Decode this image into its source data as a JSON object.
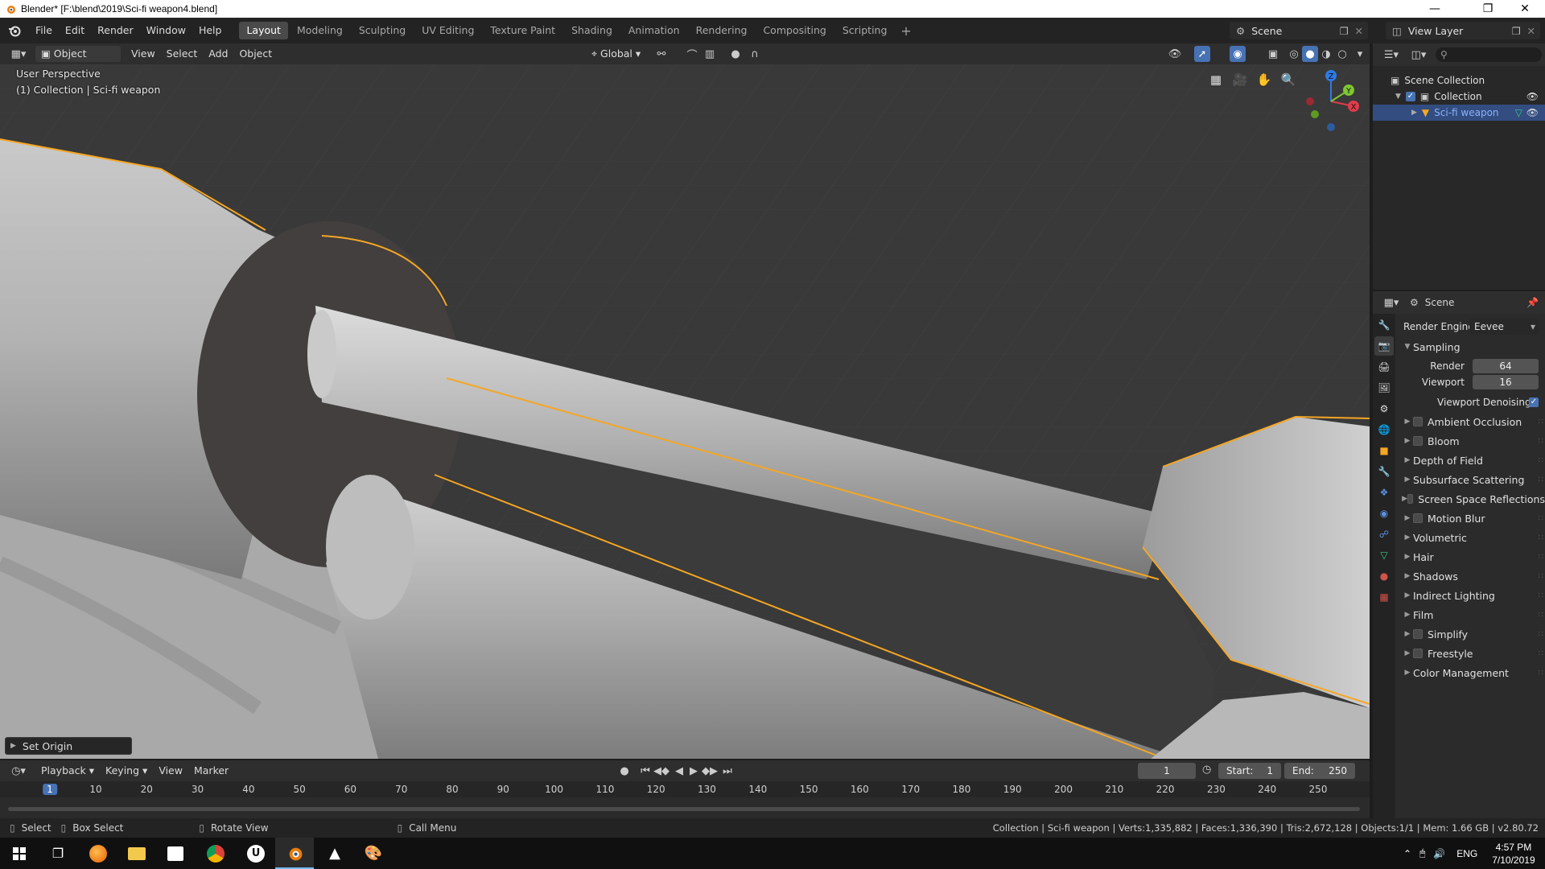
{
  "window": {
    "title": "Blender* [F:\\blend\\2019\\Sci-fi weapon4.blend]",
    "controls": [
      "minimize",
      "maximize",
      "close"
    ]
  },
  "topbar": {
    "menus": [
      "File",
      "Edit",
      "Render",
      "Window",
      "Help"
    ],
    "workspaces": [
      "Layout",
      "Modeling",
      "Sculpting",
      "UV Editing",
      "Texture Paint",
      "Shading",
      "Animation",
      "Rendering",
      "Compositing",
      "Scripting"
    ],
    "active_workspace": "Layout",
    "add_workspace": "+",
    "scene": "Scene",
    "view_layer": "View Layer"
  },
  "viewport_header": {
    "mode": "Object Mode",
    "menus": [
      "View",
      "Select",
      "Add",
      "Object"
    ],
    "orientation": "Global"
  },
  "viewport": {
    "perspective": "User Perspective",
    "collection_info": "(1) Collection | Sci-fi weapon",
    "gizmo_axes": [
      "X",
      "Y",
      "Z"
    ],
    "last_operator": "Set Origin"
  },
  "outliner": {
    "root": "Scene Collection",
    "items": [
      {
        "label": "Collection",
        "checked": true
      },
      {
        "label": "Sci-fi weapon",
        "selected": true
      }
    ]
  },
  "properties": {
    "context": "Scene",
    "render_engine_label": "Render Engine",
    "render_engine": "Eevee",
    "sampling": {
      "title": "Sampling",
      "render_label": "Render",
      "render": "64",
      "viewport_label": "Viewport",
      "viewport": "16",
      "denoising_label": "Viewport Denoising",
      "denoising": true
    },
    "panels": [
      {
        "label": "Ambient Occlusion",
        "checkbox": true
      },
      {
        "label": "Bloom",
        "checkbox": true
      },
      {
        "label": "Depth of Field",
        "checkbox": false
      },
      {
        "label": "Subsurface Scattering",
        "checkbox": false
      },
      {
        "label": "Screen Space Reflections",
        "checkbox": true
      },
      {
        "label": "Motion Blur",
        "checkbox": true
      },
      {
        "label": "Volumetric",
        "checkbox": false
      },
      {
        "label": "Hair",
        "checkbox": false
      },
      {
        "label": "Shadows",
        "checkbox": false
      },
      {
        "label": "Indirect Lighting",
        "checkbox": false
      },
      {
        "label": "Film",
        "checkbox": false
      },
      {
        "label": "Simplify",
        "checkbox": true
      },
      {
        "label": "Freestyle",
        "checkbox": true
      },
      {
        "label": "Color Management",
        "checkbox": false
      }
    ]
  },
  "timeline": {
    "menus": [
      "Playback",
      "Keying",
      "View",
      "Marker"
    ],
    "current_frame": "1",
    "start_label": "Start:",
    "start": "1",
    "end_label": "End:",
    "end": "250",
    "ruler_labels": [
      "1",
      "10",
      "20",
      "30",
      "40",
      "50",
      "60",
      "70",
      "80",
      "90",
      "100",
      "110",
      "120",
      "130",
      "140",
      "150",
      "160",
      "170",
      "180",
      "190",
      "200",
      "210",
      "220",
      "230",
      "240",
      "250"
    ]
  },
  "statusbar": {
    "select": "Select",
    "box_select": "Box Select",
    "rotate_view": "Rotate View",
    "call_menu": "Call Menu",
    "stats": "Collection | Sci-fi weapon | Verts:1,335,882 | Faces:1,336,390 | Tris:2,672,128 | Objects:1/1 | Mem: 1.66 GB | v2.80.72"
  },
  "taskbar": {
    "language": "ENG",
    "time": "4:57 PM",
    "date": "7/10/2019"
  },
  "colors": {
    "accent": "#4772b3",
    "selection_outline": "#f5a623",
    "timeline_current": "#4772b3"
  }
}
